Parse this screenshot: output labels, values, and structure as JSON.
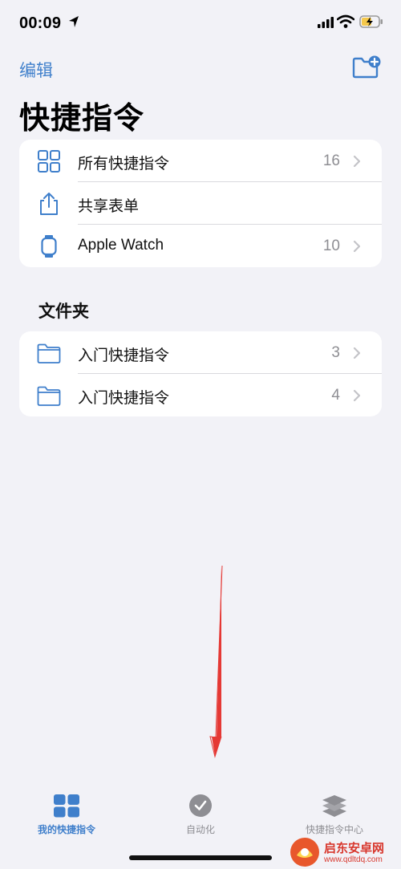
{
  "status_bar": {
    "time": "00:09"
  },
  "nav": {
    "edit_label": "编辑"
  },
  "page_title": "快捷指令",
  "shortcut_rows": [
    {
      "label": "所有快捷指令",
      "count": "16",
      "icon": "grid-icon"
    },
    {
      "label": "共享表单",
      "count": "",
      "icon": "share-icon"
    },
    {
      "label": "Apple Watch",
      "count": "10",
      "icon": "watch-icon"
    }
  ],
  "folders_section": {
    "title": "文件夹",
    "rows": [
      {
        "label": "入门快捷指令",
        "count": "3",
        "icon": "folder-icon"
      },
      {
        "label": "入门快捷指令",
        "count": "4",
        "icon": "folder-icon"
      }
    ]
  },
  "tabs": [
    {
      "label": "我的快捷指令",
      "icon": "grid-icon",
      "active": true
    },
    {
      "label": "自动化",
      "icon": "clock-icon",
      "active": false
    },
    {
      "label": "快捷指令中心",
      "icon": "layers-icon",
      "active": false
    }
  ],
  "watermark": {
    "text": "启东安卓网",
    "sub": "www.qdltdq.com"
  },
  "colors": {
    "accent": "#3F7FCB",
    "background": "#F2F2F7",
    "secondary_text": "#8E8E93",
    "annotation_arrow": "#E53935"
  }
}
